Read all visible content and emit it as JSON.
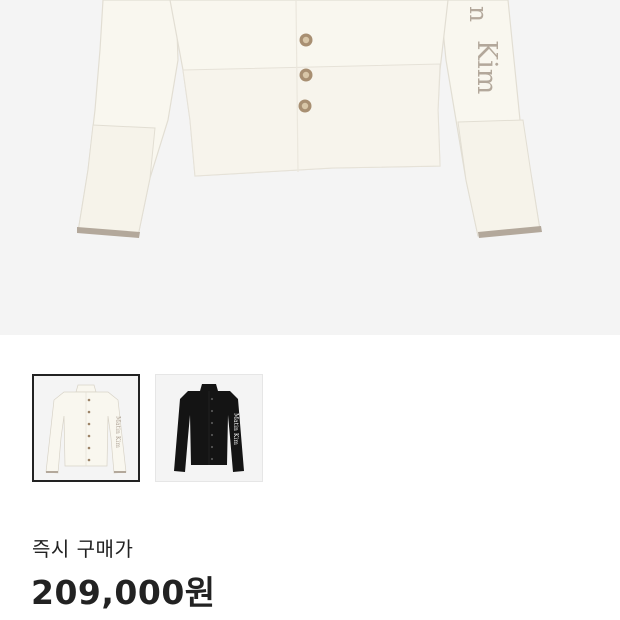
{
  "product": {
    "sleeve_text": "Kim",
    "sleeve_text_partial": "n",
    "colors": {
      "cream": "#f9f7ef",
      "trim": "#b3a89b",
      "black": "#141414",
      "background": "#f4f4f4"
    }
  },
  "thumbnails": [
    {
      "name": "cream cardigan",
      "selected": true,
      "sleeve_text": "Matin Kim"
    },
    {
      "name": "black cardigan",
      "selected": false,
      "sleeve_text": "Matin Kim"
    }
  ],
  "price": {
    "label": "즉시 구매가",
    "value": "209,000원"
  }
}
